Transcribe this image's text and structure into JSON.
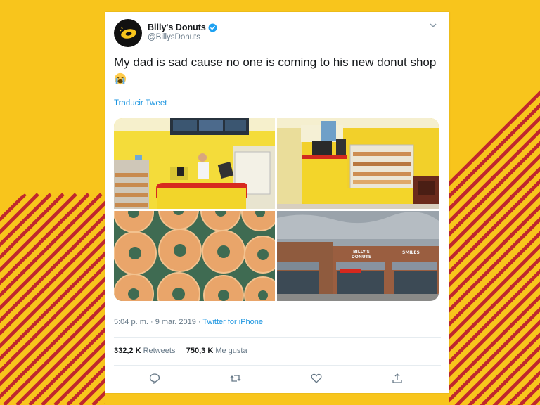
{
  "tweet": {
    "display_name": "Billy's Donuts",
    "handle": "@BillysDonuts",
    "verified": true,
    "text": "My dad is sad cause no one is coming to his new donut shop",
    "emoji": "loudly-crying-face",
    "translate_label": "Traducir Tweet",
    "time": "5:04 p. m.",
    "separator": "·",
    "date": "9 mar. 2019",
    "source": "Twitter for iPhone",
    "retweets_count": "332,2 K",
    "retweets_label": "Retweets",
    "likes_count": "750,3 K",
    "likes_label": "Me gusta"
  },
  "photos": [
    {
      "subject": "shop counter with man behind register"
    },
    {
      "subject": "donut display case and yellow counter"
    },
    {
      "subject": "glazed donuts close-up"
    },
    {
      "subject": "Billy's Donuts storefront in strip mall"
    }
  ],
  "storefront_signs": {
    "billys": "BILLY'S DONUTS",
    "smiles": "SMILES"
  },
  "icons": {
    "avatar": "billys-donuts-logo",
    "verified": "verified-badge-icon",
    "menu": "chevron-down-icon",
    "reply": "reply-icon",
    "retweet": "retweet-icon",
    "like": "heart-icon",
    "share": "share-icon"
  },
  "colors": {
    "background": "#f8c51c",
    "stripes": "#c0272d",
    "link": "#1b95e0",
    "secondary_text": "#657786"
  }
}
